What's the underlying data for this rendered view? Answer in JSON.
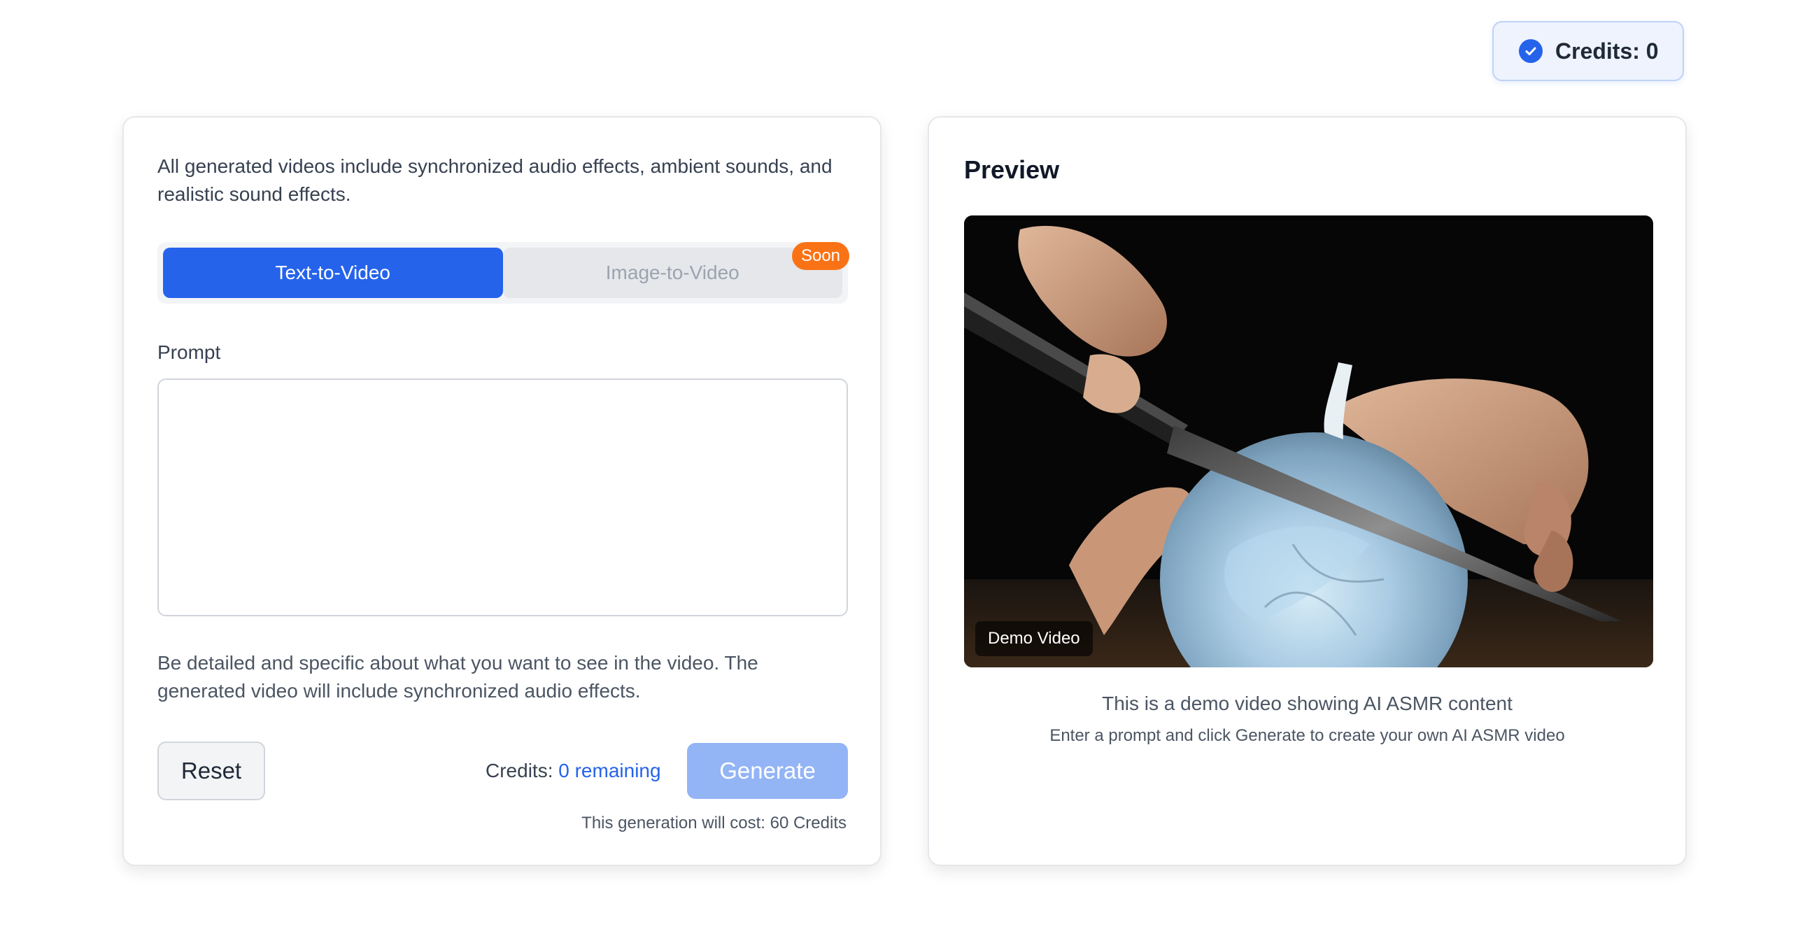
{
  "header": {
    "credits_label": "Credits: 0",
    "icon": "check-circle-icon"
  },
  "generator": {
    "intro": "All generated videos include synchronized audio effects, ambient sounds, and realistic sound effects.",
    "tabs": [
      {
        "label": "Text-to-Video",
        "active": true
      },
      {
        "label": "Image-to-Video",
        "active": false
      }
    ],
    "soon_badge": "Soon",
    "prompt_label": "Prompt",
    "prompt_value": "",
    "prompt_placeholder": "",
    "hint": "Be detailed and specific about what you want to see in the video. The generated video will include synchronized audio effects.",
    "reset_label": "Reset",
    "credits_prefix": "Credits:",
    "credits_remaining": "0 remaining",
    "generate_label": "Generate",
    "cost_note": "This generation will cost: 60 Credits"
  },
  "preview": {
    "title": "Preview",
    "demo_label": "Demo Video",
    "caption": "This is a demo video showing AI ASMR content",
    "subcaption": "Enter a prompt and click Generate to create your own AI ASMR video"
  },
  "colors": {
    "accent": "#2563eb",
    "badge": "#f97316",
    "generate_disabled": "#93b4f5"
  }
}
